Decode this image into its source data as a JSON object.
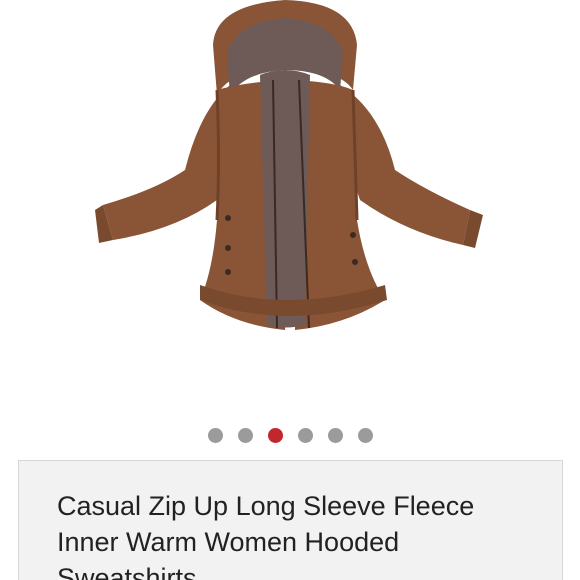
{
  "product": {
    "image_description_icon": "hooded-fleece-coat-image",
    "title": "Casual Zip Up Long Sleeve Fleece Inner Warm Women Hooded Sweatshirts"
  },
  "carousel": {
    "count": 6,
    "active_index": 2,
    "dot_color": "#9b9b9b",
    "active_color": "#c1272d"
  },
  "colors": {
    "coat_brown": "#8a5536",
    "fleece": "#6e5a57",
    "card_bg": "#f2f2f2"
  }
}
